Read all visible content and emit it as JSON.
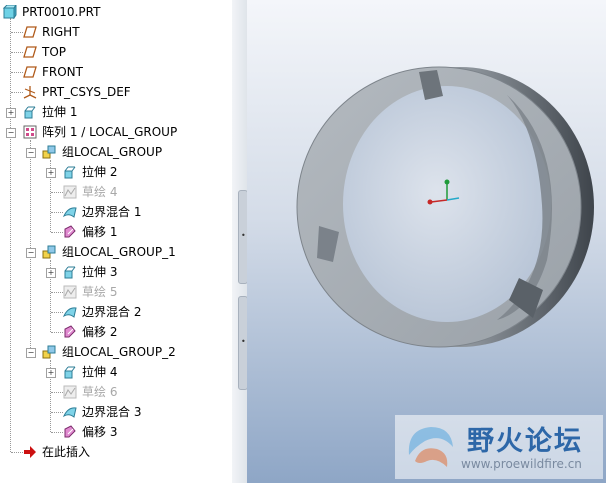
{
  "model_tree": {
    "root": "PRT0010.PRT",
    "datum_right": "RIGHT",
    "datum_top": "TOP",
    "datum_front": "FRONT",
    "csys": "PRT_CSYS_DEF",
    "extrude1": "拉伸 1",
    "pattern1": "阵列 1 / LOCAL_GROUP",
    "group0": {
      "label": "组LOCAL_GROUP",
      "extrude": "拉伸 2",
      "sketch": "草绘 4",
      "blend": "边界混合 1",
      "offset": "偏移 1"
    },
    "group1": {
      "label": "组LOCAL_GROUP_1",
      "extrude": "拉伸 3",
      "sketch": "草绘 5",
      "blend": "边界混合 2",
      "offset": "偏移 2"
    },
    "group2": {
      "label": "组LOCAL_GROUP_2",
      "extrude": "拉伸 4",
      "sketch": "草绘 6",
      "blend": "边界混合 3",
      "offset": "偏移 3"
    },
    "insert_here": "在此插入"
  },
  "watermark": {
    "cn": "野火论坛",
    "url": "www.proewildfire.cn"
  },
  "colors": {
    "tree_background": "#ffffff",
    "view_top": "#f4f6fa",
    "view_bottom": "#8ea6c6",
    "insert_arrow": "#cc1010",
    "watermark_text": "#2d67a8"
  },
  "icons": {
    "part": "part-icon",
    "datum_plane": "datum-plane-icon",
    "csys": "csys-icon",
    "extrude": "extrude-icon",
    "pattern": "pattern-icon",
    "group": "group-icon",
    "sketch": "sketch-icon",
    "boundary_blend": "boundary-blend-icon",
    "offset": "offset-icon",
    "insert": "insert-arrow-icon"
  }
}
